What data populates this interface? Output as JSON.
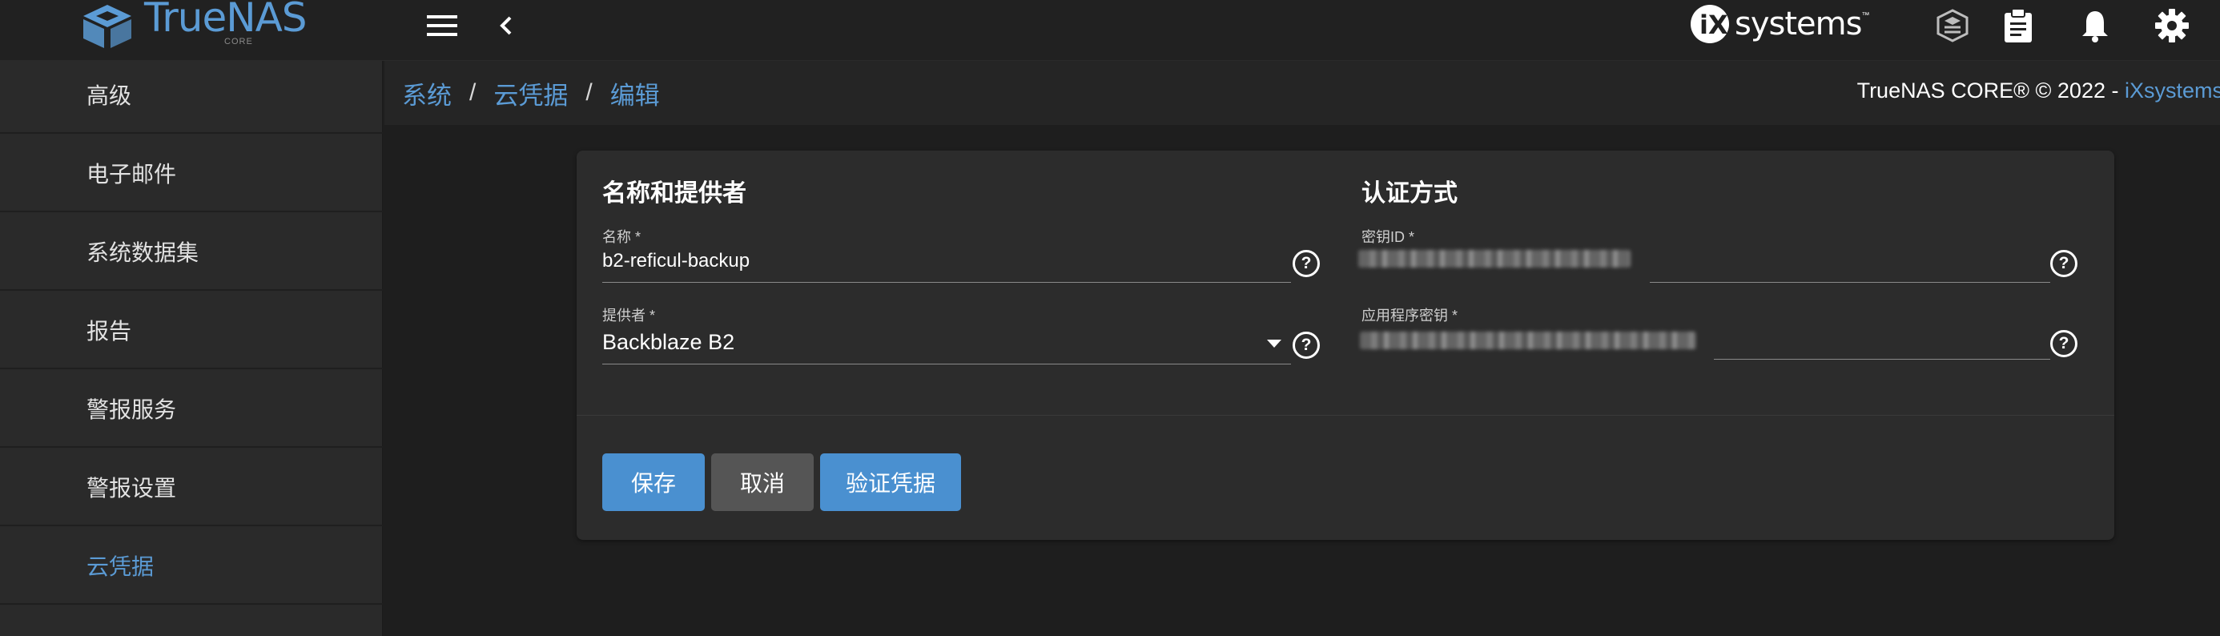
{
  "header": {
    "brand": "TrueNAS",
    "brand_sub": "CORE",
    "vendor": "systems",
    "vendor_tm": "™",
    "icons": [
      "menu-icon",
      "chevron-left-icon",
      "truecommand-icon",
      "clipboard-icon",
      "bell-icon",
      "gear-icon"
    ]
  },
  "sidebar": {
    "items": [
      {
        "label": "高级"
      },
      {
        "label": "电子邮件"
      },
      {
        "label": "系统数据集"
      },
      {
        "label": "报告"
      },
      {
        "label": "警报服务"
      },
      {
        "label": "警报设置"
      },
      {
        "label": "云凭据",
        "active": true
      }
    ]
  },
  "breadcrumb": {
    "items": [
      "系统",
      "云凭据",
      "编辑"
    ],
    "separator": "/",
    "copyright_text": "TrueNAS CORE® © 2022 - ",
    "copyright_link": "iXsystems"
  },
  "form": {
    "left_section_title": "名称和提供者",
    "right_section_title": "认证方式",
    "name": {
      "label": "名称 *",
      "value": "b2-reficul-backup"
    },
    "provider": {
      "label": "提供者 *",
      "value": "Backblaze B2"
    },
    "key_id": {
      "label": "密钥ID *",
      "value_redacted": true
    },
    "app_key": {
      "label": "应用程序密钥 *",
      "value_redacted": true
    },
    "help_glyph": "?"
  },
  "actions": {
    "save": "保存",
    "cancel": "取消",
    "verify": "验证凭据"
  },
  "colors": {
    "accent": "#5b9bd5",
    "button_primary": "#4a90d0",
    "button_secondary": "#555555",
    "background": "#1e1e1e",
    "card": "#2c2c2c"
  }
}
